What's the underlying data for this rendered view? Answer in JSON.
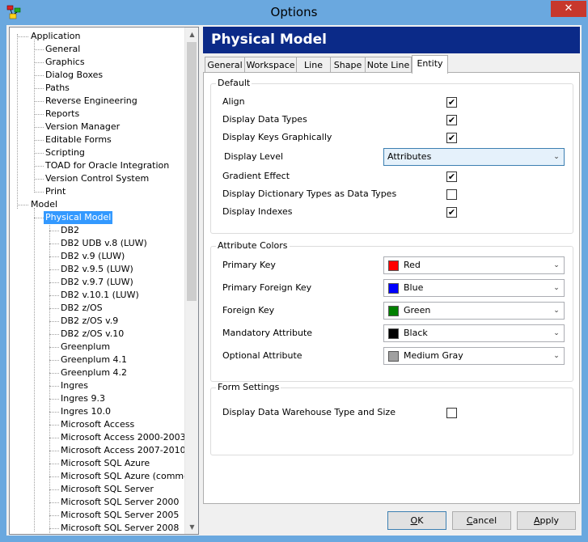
{
  "window": {
    "title": "Options",
    "close_glyph": "✕"
  },
  "tree": {
    "items": [
      {
        "label": "Application"
      },
      {
        "label": "General"
      },
      {
        "label": "Graphics"
      },
      {
        "label": "Dialog Boxes"
      },
      {
        "label": "Paths"
      },
      {
        "label": "Reverse Engineering"
      },
      {
        "label": "Reports"
      },
      {
        "label": "Version Manager"
      },
      {
        "label": "Editable Forms"
      },
      {
        "label": "Scripting"
      },
      {
        "label": "TOAD for Oracle Integration"
      },
      {
        "label": "Version Control System"
      },
      {
        "label": "Print"
      },
      {
        "label": "Model"
      },
      {
        "label": "Physical Model"
      },
      {
        "label": "DB2"
      },
      {
        "label": "DB2 UDB v.8 (LUW)"
      },
      {
        "label": "DB2 v.9 (LUW)"
      },
      {
        "label": "DB2 v.9.5 (LUW)"
      },
      {
        "label": "DB2 v.9.7 (LUW)"
      },
      {
        "label": "DB2 v.10.1 (LUW)"
      },
      {
        "label": "DB2 z/OS"
      },
      {
        "label": "DB2 z/OS v.9"
      },
      {
        "label": "DB2 z/OS v.10"
      },
      {
        "label": "Greenplum"
      },
      {
        "label": "Greenplum 4.1"
      },
      {
        "label": "Greenplum 4.2"
      },
      {
        "label": "Ingres"
      },
      {
        "label": "Ingres 9.3"
      },
      {
        "label": "Ingres 10.0"
      },
      {
        "label": "Microsoft Access"
      },
      {
        "label": "Microsoft Access 2000-2003"
      },
      {
        "label": "Microsoft Access 2007-2010"
      },
      {
        "label": "Microsoft SQL Azure"
      },
      {
        "label": "Microsoft SQL Azure (common)"
      },
      {
        "label": "Microsoft SQL Server"
      },
      {
        "label": "Microsoft SQL Server 2000"
      },
      {
        "label": "Microsoft SQL Server 2005"
      },
      {
        "label": "Microsoft SQL Server 2008"
      }
    ],
    "selected": "Physical Model",
    "scroll_up_glyph": "▲",
    "scroll_down_glyph": "▼"
  },
  "header": {
    "title": "Physical Model"
  },
  "tabs": [
    "General",
    "Workspace",
    "Line",
    "Shape",
    "Note Line",
    "Entity"
  ],
  "active_tab": "Entity",
  "default_group": {
    "title": "Default",
    "check_glyph": "✔",
    "align": {
      "label": "Align",
      "checked": true
    },
    "display_data_types": {
      "label": "Display Data Types",
      "checked": true
    },
    "display_keys_graphically": {
      "label": "Display Keys Graphically",
      "checked": true
    },
    "display_level": {
      "label": "Display Level",
      "value": "Attributes"
    },
    "gradient_effect": {
      "label": "Gradient Effect",
      "checked": true
    },
    "display_dictionary_types": {
      "label": "Display Dictionary Types as Data Types",
      "checked": false
    },
    "display_indexes": {
      "label": "Display Indexes",
      "checked": true
    }
  },
  "attribute_colors": {
    "title": "Attribute Colors",
    "rows": [
      {
        "label": "Primary Key",
        "value": "Red",
        "color": "#ff0000"
      },
      {
        "label": "Primary Foreign Key",
        "value": "Blue",
        "color": "#0000ff"
      },
      {
        "label": "Foreign Key",
        "value": "Green",
        "color": "#008000"
      },
      {
        "label": "Mandatory Attribute",
        "value": "Black",
        "color": "#000000"
      },
      {
        "label": "Optional Attribute",
        "value": "Medium Gray",
        "color": "#a0a0a0"
      }
    ]
  },
  "form_settings": {
    "title": "Form Settings",
    "display_dw_type_size": {
      "label": "Display Data Warehouse Type and Size",
      "checked": false
    }
  },
  "buttons": {
    "ok": {
      "mnemonic": "O",
      "rest": "K"
    },
    "cancel": {
      "mnemonic": "C",
      "rest": "ancel"
    },
    "apply": {
      "mnemonic": "A",
      "rest": "pply"
    }
  },
  "dropdown_glyph": "⌄",
  "colors": {
    "header_bg": "#0b2a88",
    "selection": "#3399ff",
    "titlebar": "#6aa8df"
  }
}
